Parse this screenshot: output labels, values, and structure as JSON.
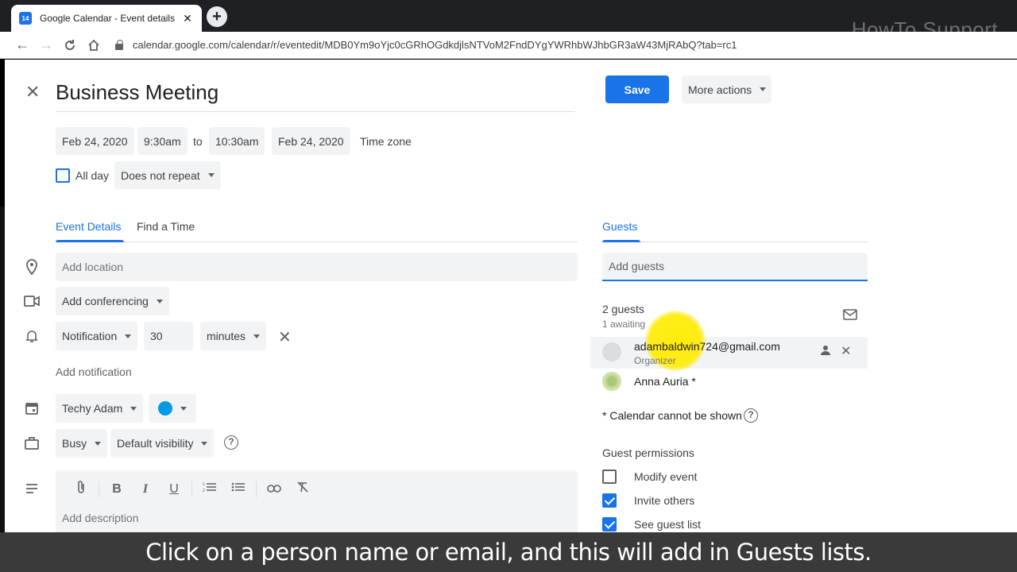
{
  "browser": {
    "tab_title": "Google Calendar - Event details",
    "tab_icon_text": "14",
    "url": "calendar.google.com/calendar/r/eventedit/MDB0Ym9oYjc0cGRhOGdkdjlsNTVoM2FndDYgYWRhbWJhbGR3aW43MjRAbQ?tab=rc1",
    "watermark": "HowTo Support"
  },
  "event": {
    "title": "Business Meeting",
    "save_label": "Save",
    "more_actions_label": "More actions",
    "start_date": "Feb 24, 2020",
    "start_time": "9:30am",
    "to_label": "to",
    "end_time": "10:30am",
    "end_date": "Feb 24, 2020",
    "time_zone_label": "Time zone",
    "all_day_label": "All day",
    "repeat_label": "Does not repeat"
  },
  "tabs": {
    "event_details": "Event Details",
    "find_time": "Find a Time"
  },
  "details": {
    "location_placeholder": "Add location",
    "conferencing_label": "Add conferencing",
    "notification_label": "Notification",
    "notification_value": "30",
    "notification_unit": "minutes",
    "add_notification": "Add notification",
    "calendar_name": "Techy Adam",
    "calendar_color": "#039be5",
    "busy_label": "Busy",
    "visibility_label": "Default visibility",
    "description_placeholder": "Add description"
  },
  "guests": {
    "tab_label": "Guests",
    "add_placeholder": "Add guests",
    "count": "2 guests",
    "awaiting": "1 awaiting",
    "list": [
      {
        "name": "adambaldwin724@gmail.com",
        "role": "Organizer"
      },
      {
        "name": "Anna Auria *",
        "role": ""
      }
    ],
    "calendar_note": "* Calendar cannot be shown",
    "permissions_title": "Guest permissions",
    "permissions": [
      {
        "label": "Modify event",
        "checked": false
      },
      {
        "label": "Invite others",
        "checked": true
      },
      {
        "label": "See guest list",
        "checked": true
      }
    ]
  },
  "caption": "Click on a person name or email, and this will add in Guests lists."
}
